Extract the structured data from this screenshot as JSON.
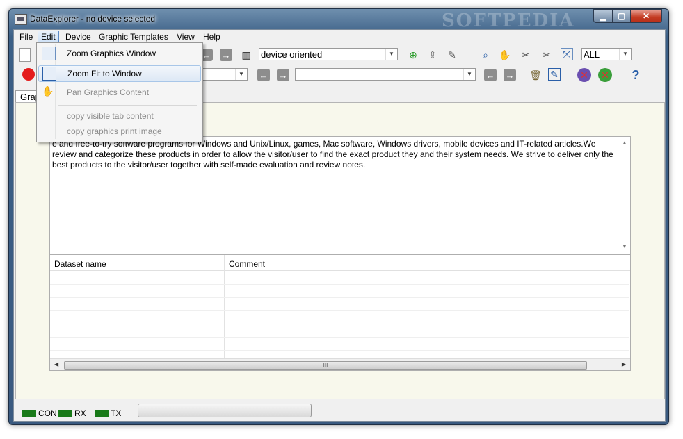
{
  "window": {
    "title": "DataExplorer  -  no device selected",
    "watermark": "SOFTPEDIA"
  },
  "menubar": {
    "items": [
      "File",
      "Edit",
      "Device",
      "Graphic Templates",
      "View",
      "Help"
    ],
    "active": "Edit"
  },
  "toolbar": {
    "view_mode_combo": "device oriented",
    "channel_combo": "ALL",
    "combo_empty_1": "",
    "combo_empty_2": ""
  },
  "tab": {
    "label": "Grap"
  },
  "description": {
    "text": "e and free-to-try software programs for Windows and Unix/Linux, games, Mac software, Windows drivers, mobile devices and IT-related articles.We review and categorize these products in order to allow the visitor/user to find the exact product they and their system needs. We strive to deliver only the best products to the visitor/user together with self-made evaluation and review notes."
  },
  "table": {
    "columns": [
      "Dataset name",
      "Comment"
    ],
    "hscroll_label": "III"
  },
  "status": {
    "con": "CON",
    "rx": "RX",
    "tx": "TX",
    "con_color": "#197a19"
  },
  "edit_menu": {
    "items": [
      {
        "label": "Zoom Graphics Window",
        "enabled": true
      },
      {
        "label": "Zoom Fit to Window",
        "enabled": true
      },
      {
        "label": "Pan Graphics Content",
        "enabled": false
      },
      {
        "label": "copy visible tab content",
        "enabled": false
      },
      {
        "label": "copy graphics print image",
        "enabled": false
      }
    ]
  }
}
